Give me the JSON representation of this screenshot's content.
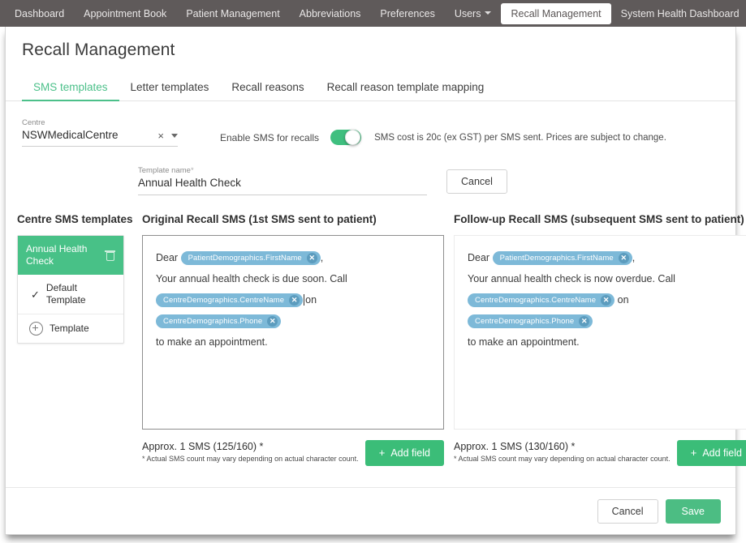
{
  "topnav": {
    "items": [
      {
        "label": "Dashboard",
        "active": false,
        "dropdown": false
      },
      {
        "label": "Appointment Book",
        "active": false,
        "dropdown": false
      },
      {
        "label": "Patient Management",
        "active": false,
        "dropdown": false
      },
      {
        "label": "Abbreviations",
        "active": false,
        "dropdown": false
      },
      {
        "label": "Preferences",
        "active": false,
        "dropdown": false
      },
      {
        "label": "Users",
        "active": false,
        "dropdown": true
      },
      {
        "label": "Recall Management",
        "active": true,
        "dropdown": false
      },
      {
        "label": "System Health Dashboard",
        "active": false,
        "dropdown": false
      }
    ]
  },
  "page": {
    "title": "Recall Management"
  },
  "tabs": [
    {
      "label": "SMS templates",
      "active": true
    },
    {
      "label": "Letter templates",
      "active": false
    },
    {
      "label": "Recall reasons",
      "active": false
    },
    {
      "label": "Recall reason template mapping",
      "active": false
    }
  ],
  "centre": {
    "label": "Centre",
    "value": "NSWMedicalCentre",
    "clear_icon": "×"
  },
  "sms_toggle": {
    "label": "Enable SMS for recalls",
    "enabled": true,
    "note": "SMS cost is 20c (ex GST) per SMS sent. Prices are subject to change."
  },
  "template_name": {
    "label": "Template name",
    "required_marker": "*",
    "value": "Annual Health Check",
    "cancel_label": "Cancel"
  },
  "sidebar": {
    "heading": "Centre SMS templates",
    "items": [
      {
        "label": "Annual Health Check",
        "selected": true,
        "icon": "trash-icon"
      },
      {
        "label": "Default Template",
        "selected": false,
        "icon": "check-icon"
      },
      {
        "label": "Template",
        "selected": false,
        "icon": "plus-circle-icon"
      }
    ]
  },
  "original_sms": {
    "heading": "Original Recall SMS (1st SMS sent to patient)",
    "line1_prefix": "Dear",
    "line1_chip": "PatientDemographics.FirstName",
    "line1_suffix": ",",
    "line2": "Your annual health check is due soon. Call",
    "line3_chip1": "CentreDemographics.CentreName",
    "line3_mid": "on",
    "line3_chip2": "CentreDemographics.Phone",
    "line4": "to make an appointment.",
    "count": "Approx. 1 SMS (125/160) *",
    "count_note": "* Actual SMS count may vary depending on actual character count.",
    "add_field_label": "Add field",
    "add_field_plus": "+"
  },
  "followup_sms": {
    "heading": "Follow-up Recall SMS (subsequent SMS sent to patient)",
    "line1_prefix": "Dear",
    "line1_chip": "PatientDemographics.FirstName",
    "line1_suffix": ",",
    "line2": "Your annual health check is now overdue. Call",
    "line3_chip1": "CentreDemographics.CentreName",
    "line3_mid": "on",
    "line3_chip2": "CentreDemographics.Phone",
    "line4": "to make an appointment.",
    "count": "Approx. 1 SMS (130/160) *",
    "count_note": "* Actual SMS count may vary depending on actual character count.",
    "add_field_label": "Add field",
    "add_field_plus": "+"
  },
  "footer": {
    "cancel_label": "Cancel",
    "save_label": "Save"
  },
  "colors": {
    "accent_green": "#3bbd78",
    "tab_green": "#4cc08a",
    "chip_blue": "#7db9d8",
    "nav_bg": "#5f5a5a"
  }
}
